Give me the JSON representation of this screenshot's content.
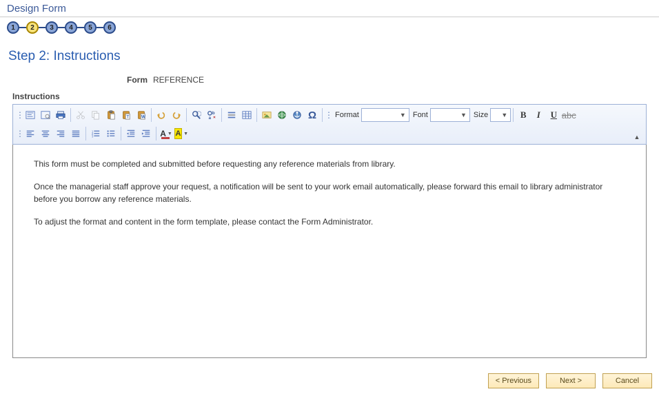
{
  "page_title": "Design Form",
  "stepper": {
    "steps": [
      "1",
      "2",
      "3",
      "4",
      "5",
      "6"
    ],
    "active_index": 1
  },
  "step_heading": "Step 2: Instructions",
  "form_name_label": "Form",
  "form_name_value": "REFERENCE",
  "instructions_label": "Instructions",
  "toolbar": {
    "format_label": "Format",
    "font_label": "Font",
    "size_label": "Size",
    "format_value": "",
    "font_value": "",
    "size_value": "",
    "bold": "B",
    "italic": "I",
    "underline": "U",
    "strike": "abc",
    "text_color_glyph": "A",
    "highlight_glyph": "A"
  },
  "editor_content": {
    "p1": "This form must be completed and submitted before requesting any reference materials from library.",
    "p2": "Once the managerial staff approve your request, a notification will be sent to your work email automatically, please forward this email to library administrator before you borrow any reference materials.",
    "p3": "To adjust the format and content in the form template, please contact the Form Administrator."
  },
  "buttons": {
    "previous": "< Previous",
    "next": "Next >",
    "cancel": "Cancel"
  }
}
